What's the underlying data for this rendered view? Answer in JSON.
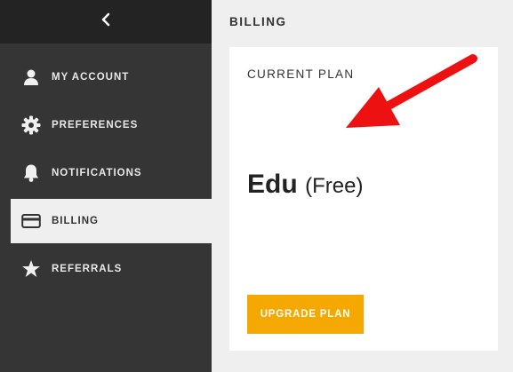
{
  "sidebar": {
    "back_icon": "chevron-left-icon",
    "items": [
      {
        "label": "MY ACCOUNT",
        "icon": "user-icon",
        "active": false
      },
      {
        "label": "PREFERENCES",
        "icon": "gear-icon",
        "active": false
      },
      {
        "label": "NOTIFICATIONS",
        "icon": "bell-icon",
        "active": false
      },
      {
        "label": "BILLING",
        "icon": "credit-card-icon",
        "active": true
      },
      {
        "label": "REFERRALS",
        "icon": "star-icon",
        "active": false
      }
    ]
  },
  "main": {
    "title": "BILLING",
    "card": {
      "label": "CURRENT PLAN",
      "plan_name": "Edu",
      "plan_tier": "(Free)",
      "upgrade_label": "UPGRADE PLAN"
    }
  },
  "colors": {
    "sidebar_bg": "#353535",
    "sidebar_header_bg": "#232323",
    "accent": "#f5a800",
    "annotation_arrow": "#ee1111"
  }
}
